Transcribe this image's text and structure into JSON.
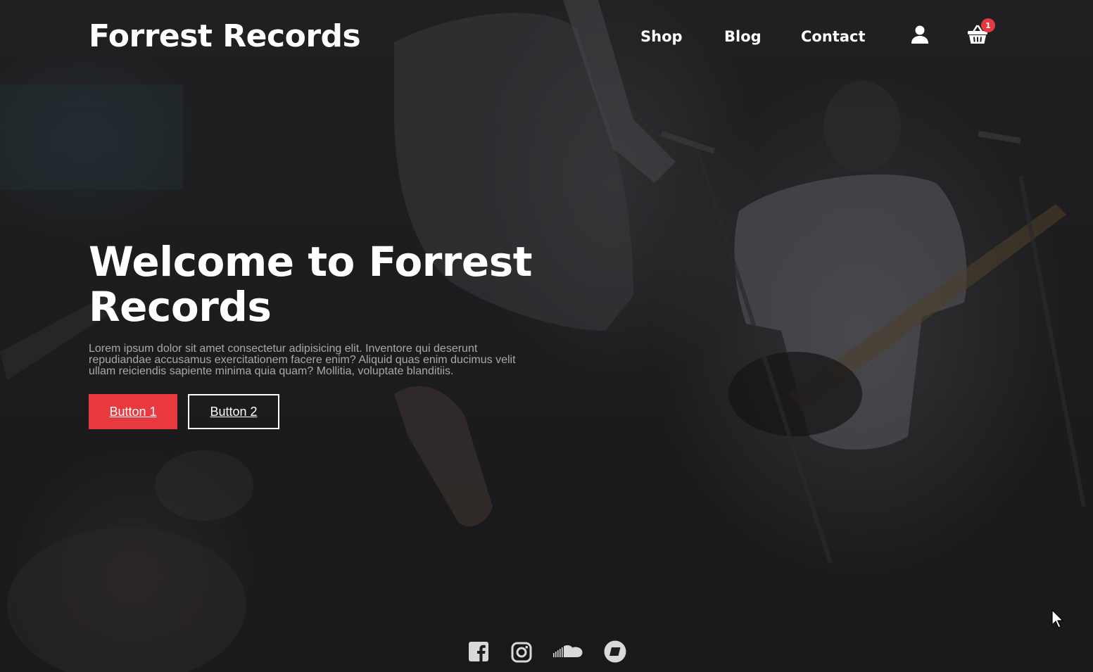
{
  "header": {
    "logo": "Forrest Records",
    "nav": {
      "shop": "Shop",
      "blog": "Blog",
      "contact": "Contact"
    },
    "icons": {
      "account": "user-icon",
      "cart": "basket-icon"
    },
    "cart_count": "1"
  },
  "hero": {
    "title": "Welcome to Forrest Records",
    "description": "Lorem ipsum dolor sit amet consectetur adipisicing elit. Inventore qui deserunt repudiandae accusamus exercitationem facere enim? Aliquid quas enim ducimus velit ullam reiciendis sapiente minima quia quam? Mollitia, voluptate blanditiis.",
    "button1": "Button 1",
    "button2": "Button 2"
  },
  "social": [
    "facebook-icon",
    "instagram-icon",
    "soundcloud-icon",
    "bandcamp-icon"
  ],
  "colors": {
    "accent": "#e8393f",
    "background": "#1b1b1d",
    "text": "#ffffff",
    "muted_text": "#a9a9ab"
  }
}
